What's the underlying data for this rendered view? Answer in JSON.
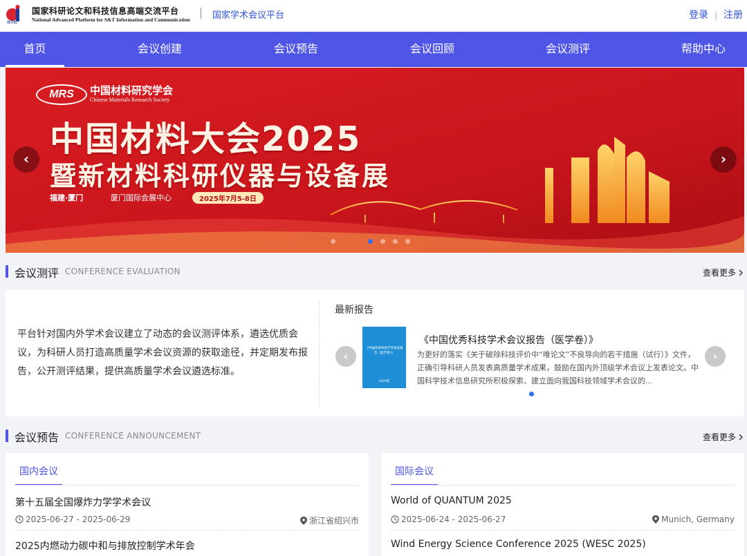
{
  "header": {
    "logo_text": "iSTIC",
    "logo_cn": "国家科研论文和科技信息高端交流平台",
    "logo_en": "National Advanced Platform for S&T Information and Communication",
    "platform_name": "国家学术会议平台",
    "login": "登录",
    "register": "注册"
  },
  "nav": {
    "items": [
      "首页",
      "会议创建",
      "会议预告",
      "会议回顾",
      "会议测评",
      "帮助中心"
    ],
    "active": "首页"
  },
  "banner": {
    "org_logo": "MRS",
    "org_cn": "中国材料研究学会",
    "org_en": "Chinese Materials Research Society",
    "title1": "中国材料大会2025",
    "title2": "暨新材料科研仪器与设备展",
    "location": "福建·厦门",
    "venue": "厦门国际会展中心",
    "date": "2025年7月5-8日",
    "prev_label": "‹",
    "next_label": "›",
    "slide_count": 5,
    "active_slide": 1
  },
  "evaluation": {
    "title": "会议测评",
    "subtitle": "CONFERENCE EVALUATION",
    "more": "查看更多",
    "description": "平台针对国内外学术会议建立了动态的会议测评体系，遴选优质会议，为科研人员打造高质量学术会议资源的获取途径，并定期发布报告，公开测评结果，提供高质量学术会议遴选标准。",
    "latest_label": "最新报告",
    "report": {
      "cover_title": "《中国优秀科技学术会议报告（医学卷）》",
      "cover_year": "2024年",
      "title": "《中国优秀科技学术会议报告（医学卷）》",
      "summary": "为更好的落实《关于破除科技评价中“唯论文”不良导向的若干措施（试行）》文件，正确引导科研人员发表高质量学术成果，鼓励在国内外顶级学术会议上发表论文。中国科学技术信息研究所积极探索、建立面向我国科技领域学术会议的..."
    },
    "prev_label": "‹",
    "next_label": "›"
  },
  "announcement": {
    "title": "会议预告",
    "subtitle": "CONFERENCE ANNOUNCEMENT",
    "more": "查看更多",
    "domestic": {
      "tab": "国内会议",
      "items": [
        {
          "name": "第十五届全国爆炸力学学术会议",
          "date": "2025-06-27 - 2025-06-29",
          "place": "浙江省绍兴市"
        },
        {
          "name": "2025内燃动力碳中和与排放控制学术年会",
          "date": "",
          "place": ""
        }
      ]
    },
    "international": {
      "tab": "国际会议",
      "items": [
        {
          "name": "World of QUANTUM 2025",
          "date": "2025-06-24 - 2025-06-27",
          "place": "Munich, Germany"
        },
        {
          "name": "Wind Energy Science Conference 2025 (WESC 2025)",
          "date": "",
          "place": ""
        }
      ]
    }
  }
}
